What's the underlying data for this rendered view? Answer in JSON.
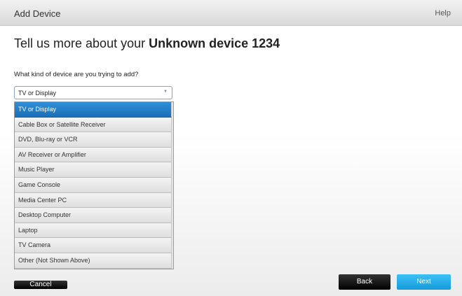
{
  "window": {
    "title": "Add Device",
    "help_label": "Help"
  },
  "main": {
    "heading_prefix": "Tell us more about your ",
    "heading_device": "Unknown device 1234",
    "question": "What kind of device are you trying to add?"
  },
  "device_select": {
    "selected": "TV or Display",
    "options": [
      "TV or Display",
      "Cable Box or Satellite Receiver",
      "DVD, Blu-ray or VCR",
      "AV Receiver or Amplifier",
      "Music Player",
      "Game Console",
      "Media Center PC",
      "Desktop Computer",
      "Laptop",
      "TV Camera",
      "Other (Not Shown Above)"
    ],
    "highlighted_index": 0
  },
  "buttons": {
    "cancel": "Cancel",
    "back": "Back",
    "next": "Next"
  },
  "colors": {
    "highlight": "#1f7fcc",
    "next_button": "#26aeea",
    "dark_button": "#111111"
  }
}
